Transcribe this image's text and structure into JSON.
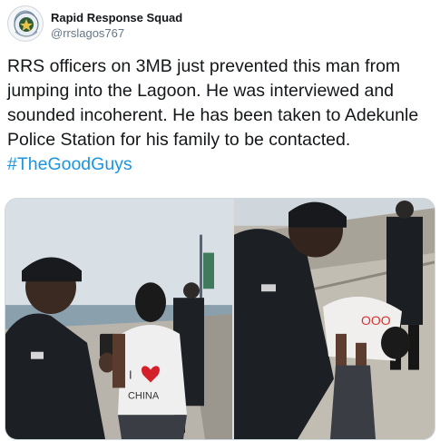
{
  "account": {
    "display_name": "Rapid Response Squad",
    "handle": "@rrslagos767",
    "avatar_icon": "police-badge-icon"
  },
  "tweet": {
    "text": "RRS officers on 3MB just prevented this man from jumping into the Lagoon. He was interviewed and sounded incoherent. He has been taken to Adekunle Police Station for his family to be contacted.",
    "hashtag": "#TheGoodGuys"
  },
  "media": {
    "photo1": {
      "shirt_text_top": "I",
      "shirt_text_bottom": "CHINA"
    },
    "photo2": {
      "shirt_text": "OOO"
    }
  },
  "colors": {
    "text": "#14171a",
    "handle": "#657786",
    "hashtag": "#1b95e0"
  }
}
